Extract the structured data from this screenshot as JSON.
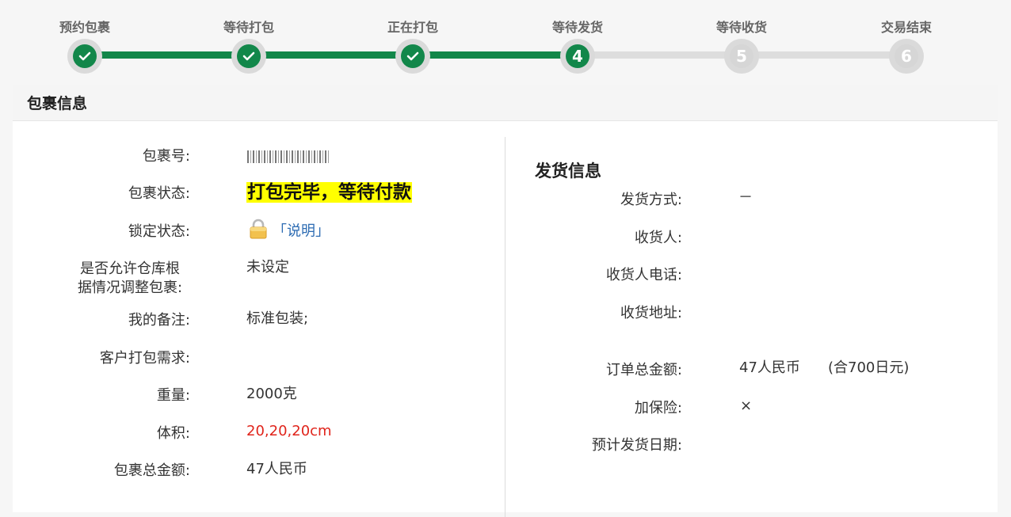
{
  "steps": [
    {
      "label": "预约包裹",
      "state": "done",
      "num": "1"
    },
    {
      "label": "等待打包",
      "state": "done",
      "num": "2"
    },
    {
      "label": "正在打包",
      "state": "done",
      "num": "3"
    },
    {
      "label": "等待发货",
      "state": "current",
      "num": "4"
    },
    {
      "label": "等待收货",
      "state": "todo",
      "num": "5"
    },
    {
      "label": "交易结束",
      "state": "todo",
      "num": "6"
    }
  ],
  "panel": {
    "title": "包裹信息",
    "left": {
      "package_no_label": "包裹号:",
      "status_label": "包裹状态:",
      "status_value": "打包完毕，等待付款",
      "lock_label": "锁定状态:",
      "lock_link": "「说明」",
      "allow_adjust_label_1": "是否允许仓库根",
      "allow_adjust_label_2": "据情况调整包裹:",
      "allow_adjust_value": "未设定",
      "remark_label": "我的备注:",
      "remark_value": "标准包装;",
      "customer_req_label": "客户打包需求:",
      "weight_label": "重量:",
      "weight_value": "2000克",
      "volume_label": "体积:",
      "volume_value": "20,20,20cm",
      "total_label": "包裹总金额:",
      "total_value": "47人民币"
    },
    "right": {
      "title": "发货信息",
      "ship_method_label": "发货方式:",
      "ship_method_value": "－",
      "receiver_label": "收货人:",
      "receiver_phone_label": "收货人电话:",
      "address_label": "收货地址:",
      "order_total_label": "订单总金额:",
      "order_total_value": "47人民币",
      "order_total_jpy": "(合700日元)",
      "insurance_label": "加保险:",
      "insurance_value": "×",
      "est_date_label": "预计发货日期:"
    }
  },
  "colors": {
    "accent_green": "#12874a",
    "status_highlight": "#ffff00",
    "volume_red": "#e0241b",
    "link_blue": "#2d6cb3"
  },
  "icons": {
    "done_step": "check-icon",
    "lock": "lock-icon"
  }
}
